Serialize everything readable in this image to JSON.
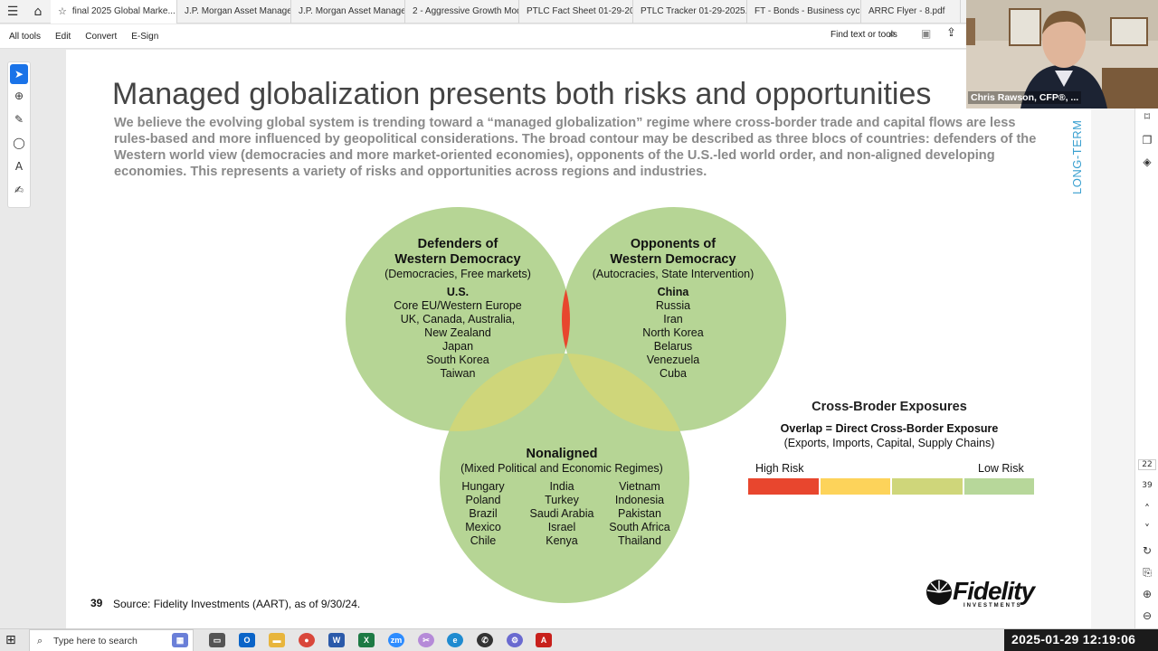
{
  "tabs": [
    {
      "label": "final 2025 Global Marke...",
      "active": true
    },
    {
      "label": "J.P. Morgan Asset Managem..."
    },
    {
      "label": "J.P. Morgan Asset Managem..."
    },
    {
      "label": "2 - Aggressive Growth Mode..."
    },
    {
      "label": "PTLC Fact Sheet 01-29-2025..."
    },
    {
      "label": "PTLC Tracker 01-29-2025.pdf"
    },
    {
      "label": "FT - Bonds - Business cycle =..."
    },
    {
      "label": "ARRC Flyer - 8.pdf"
    }
  ],
  "toolbar": {
    "all_tools": "All tools",
    "edit": "Edit",
    "convert": "Convert",
    "esign": "E-Sign",
    "find": "Find text or tools"
  },
  "slide": {
    "title": "Managed globalization presents both risks and opportunities",
    "intro": "We believe the evolving global system is trending toward a “managed globalization” regime where cross-border trade and capital flows are less rules-based and more influenced by geopolitical considerations. The broad contour may be described as three blocs of countries: defenders of the Western world view (democracies and more market-oriented economies), opponents of the U.S.-led world order, and non-aligned developing economies. This represents a variety of risks and opportunities across regions and industries.",
    "side_label": "LONG-TERM",
    "defenders": {
      "title1": "Defenders of",
      "title2": "Western Democracy",
      "subtitle": "(Democracies, Free markets)",
      "lead": "U.S.",
      "countries": [
        "Core EU/Western Europe",
        "UK, Canada, Australia,",
        "New Zealand",
        "Japan",
        "South Korea",
        "Taiwan"
      ]
    },
    "opponents": {
      "title1": "Opponents of",
      "title2": "Western Democracy",
      "subtitle": "(Autocracies, State Intervention)",
      "lead": "China",
      "countries": [
        "Russia",
        "Iran",
        "North Korea",
        "Belarus",
        "Venezuela",
        "Cuba"
      ]
    },
    "nonaligned": {
      "title": "Nonaligned",
      "subtitle": "(Mixed Political and Economic Regimes)",
      "col1": [
        "Hungary",
        "Poland",
        "Brazil",
        "Mexico",
        "Chile"
      ],
      "col2": [
        "India",
        "Turkey",
        "Saudi Arabia",
        "Israel",
        "Kenya"
      ],
      "col3": [
        "Vietnam",
        "Indonesia",
        "Pakistan",
        "South Africa",
        "Thailand"
      ]
    },
    "legend": {
      "title": "Cross-Broder Exposures",
      "overlap": "Overlap = Direct Cross-Border Exposure",
      "types": "(Exports, Imports, Capital, Supply Chains)",
      "high": "High Risk",
      "low": "Low Risk",
      "colors": [
        "#e8462e",
        "#fdd35a",
        "#cfd67a",
        "#b7d79a"
      ]
    },
    "page_number": "39",
    "source": "Source: Fidelity Investments (AART), as of 9/30/24.",
    "logo": "Fidelity",
    "logo_sub": "INVESTMENTS"
  },
  "colors": {
    "circle_green": "#b6d595",
    "overlap_red": "#e8462e",
    "overlap_yellow": "#cfd67a",
    "center_yellow": "#fdd35a"
  },
  "right_panel": {
    "page_current": "22",
    "page_total": "39"
  },
  "webcam": {
    "name": "Chris Rawson, CFP®, ..."
  },
  "taskbar": {
    "search_placeholder": "Type here to search",
    "clock": "2025-01-29  12:19:06"
  }
}
